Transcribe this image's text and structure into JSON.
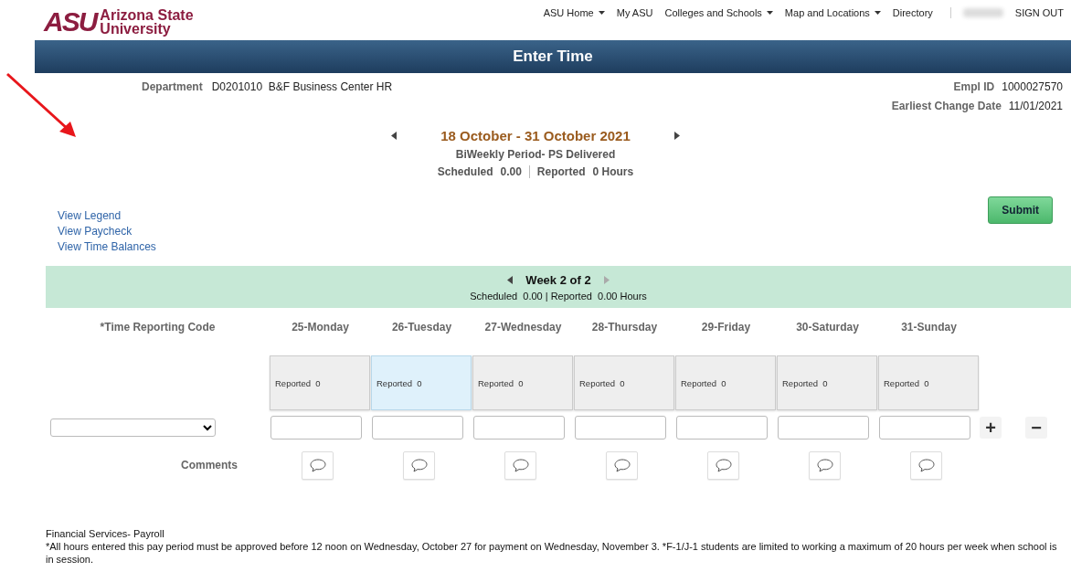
{
  "header": {
    "logo": {
      "mark": "ASU",
      "name_line1": "Arizona State",
      "name_line2": "University"
    },
    "nav": [
      {
        "label": "ASU Home",
        "dropdown": true
      },
      {
        "label": "My ASU",
        "dropdown": false
      },
      {
        "label": "Colleges and Schools",
        "dropdown": true
      },
      {
        "label": "Map and Locations",
        "dropdown": true
      },
      {
        "label": "Directory",
        "dropdown": false
      }
    ],
    "sign_out": "SIGN OUT"
  },
  "title_bar": {
    "title": "Enter Time"
  },
  "info": {
    "department_label": "Department",
    "department_value": "D0201010  B&F Business Center HR",
    "empl_id_label": "Empl ID",
    "empl_id_value": "1000027570",
    "earliest_label": "Earliest Change Date",
    "earliest_value": "11/01/2021"
  },
  "period": {
    "range": "18 October - 31 October 2021",
    "type": "BiWeekly Period- PS Delivered",
    "scheduled_label": "Scheduled",
    "scheduled_value": "0.00",
    "reported_label": "Reported",
    "reported_value": "0 Hours"
  },
  "links": [
    "View Legend",
    "View Paycheck",
    "View Time Balances"
  ],
  "submit": "Submit",
  "week": {
    "title": "Week 2 of 2",
    "summary": "Scheduled  0.00 | Reported  0.00 Hours"
  },
  "grid": {
    "code_header": "*Time Reporting Code",
    "comments_label": "Comments",
    "days": [
      {
        "label": "25-Monday",
        "reported": "Reported  0",
        "selected": false
      },
      {
        "label": "26-Tuesday",
        "reported": "Reported  0",
        "selected": true
      },
      {
        "label": "27-Wednesday",
        "reported": "Reported  0",
        "selected": false
      },
      {
        "label": "28-Thursday",
        "reported": "Reported  0",
        "selected": false
      },
      {
        "label": "29-Friday",
        "reported": "Reported  0",
        "selected": false
      },
      {
        "label": "30-Saturday",
        "reported": "Reported  0",
        "selected": false
      },
      {
        "label": "31-Sunday",
        "reported": "Reported  0",
        "selected": false
      }
    ],
    "add": "+",
    "remove": "−"
  },
  "footer": {
    "heading": "Financial Services- Payroll",
    "note": "*All hours entered this pay period must be approved before 12 noon on Wednesday, October 27 for payment on Wednesday, November 3. *F-1/J-1 students are limited to working a maximum of 20 hours per week when school is in session."
  }
}
